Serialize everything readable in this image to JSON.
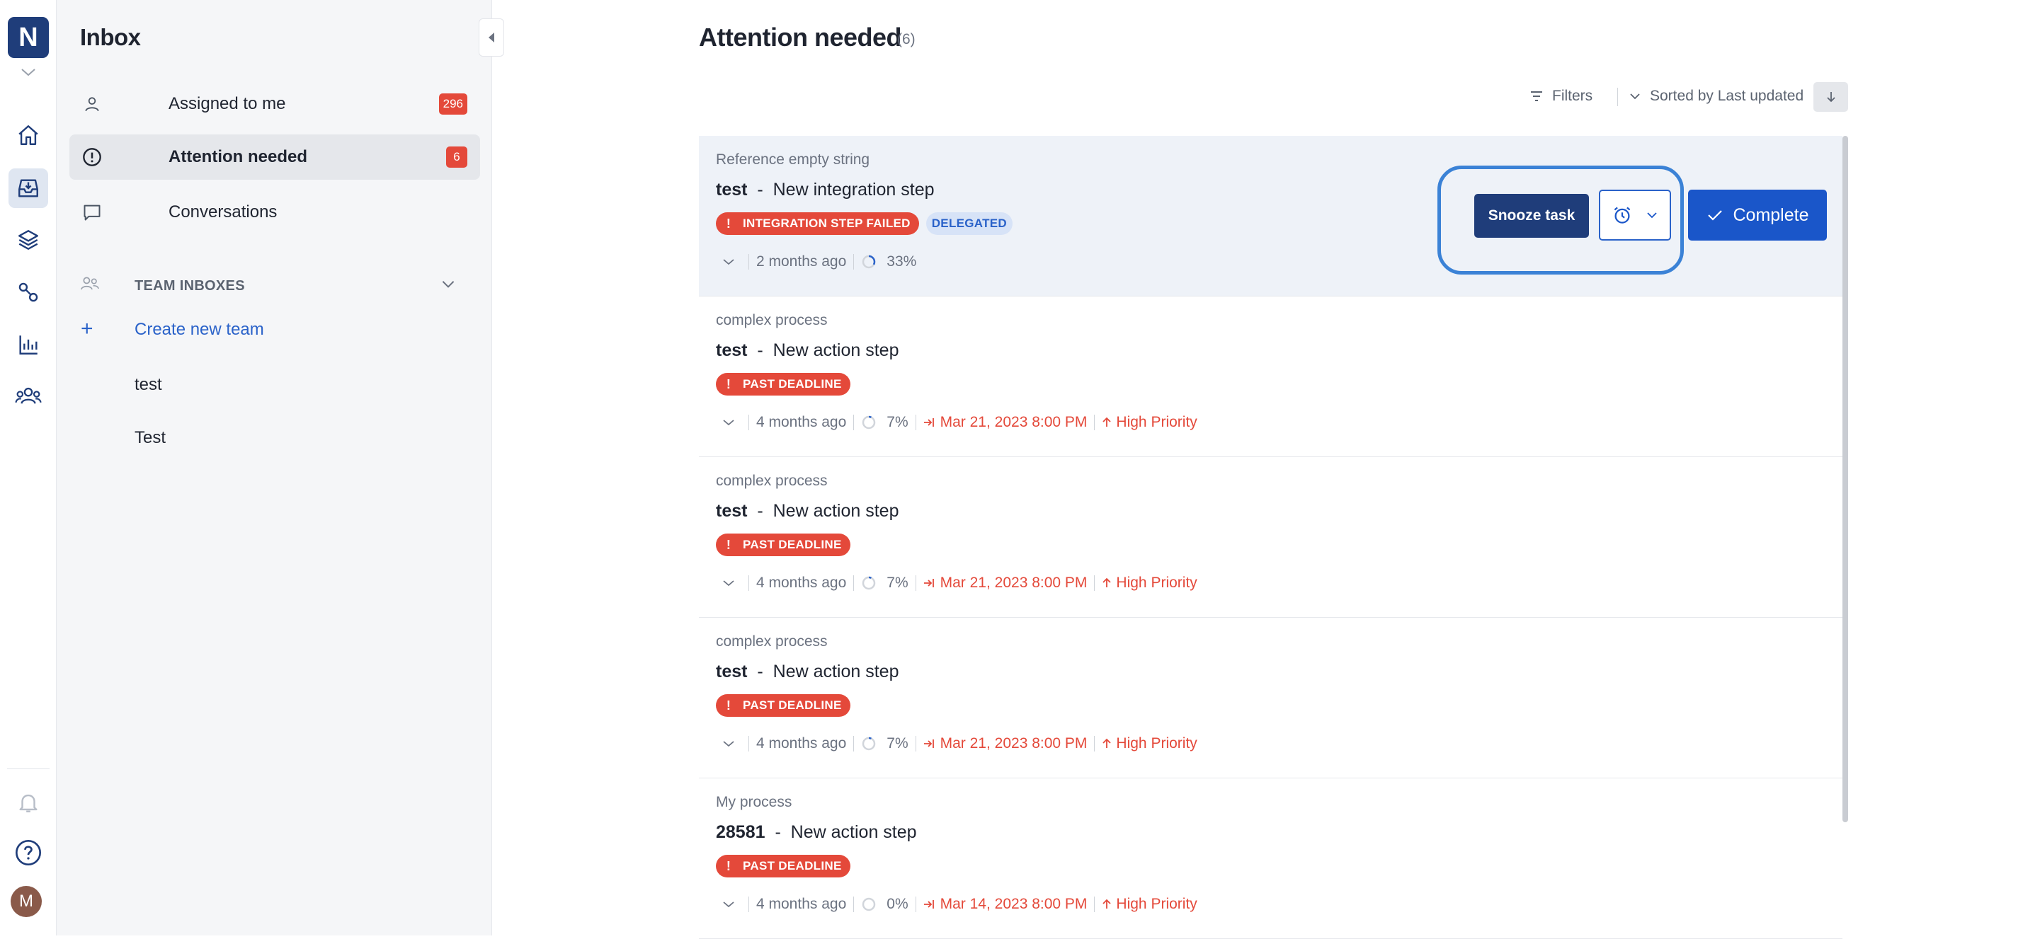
{
  "rail": {
    "logo_letter": "N",
    "avatar_initial": "M",
    "icons": [
      "home-icon",
      "inbox-icon",
      "layers-icon",
      "flow-icon",
      "chart-icon",
      "people-icon",
      "bell-icon",
      "help-icon"
    ]
  },
  "sidebar": {
    "title": "Inbox",
    "items": [
      {
        "label": "Assigned to me",
        "badge": "296"
      },
      {
        "label": "Attention needed",
        "badge": "6"
      },
      {
        "label": "Conversations",
        "badge": ""
      }
    ],
    "team_header": "TEAM INBOXES",
    "create_team": "Create new team",
    "teams": [
      "test",
      "Test"
    ]
  },
  "main": {
    "title": "Attention needed",
    "count": "(6)",
    "filters_label": "Filters",
    "sort_label": "Sorted by Last updated",
    "snooze_label": "Snooze task",
    "complete_label": "Complete",
    "tasks": [
      {
        "process": "Reference empty string",
        "id": "test",
        "dash": "-",
        "name": "New integration step",
        "tags": [
          "INTEGRATION STEP FAILED",
          "DELEGATED"
        ],
        "age": "2 months ago",
        "progress": "33%",
        "progress_value": 0.33,
        "due": "",
        "priority": ""
      },
      {
        "process": "complex process",
        "id": "test",
        "dash": "-",
        "name": "New action step",
        "tags": [
          "PAST DEADLINE"
        ],
        "age": "4 months ago",
        "progress": "7%",
        "progress_value": 0.07,
        "due": "Mar 21, 2023 8:00 PM",
        "priority": "High Priority"
      },
      {
        "process": "complex process",
        "id": "test",
        "dash": "-",
        "name": "New action step",
        "tags": [
          "PAST DEADLINE"
        ],
        "age": "4 months ago",
        "progress": "7%",
        "progress_value": 0.07,
        "due": "Mar 21, 2023 8:00 PM",
        "priority": "High Priority"
      },
      {
        "process": "complex process",
        "id": "test",
        "dash": "-",
        "name": "New action step",
        "tags": [
          "PAST DEADLINE"
        ],
        "age": "4 months ago",
        "progress": "7%",
        "progress_value": 0.07,
        "due": "Mar 21, 2023 8:00 PM",
        "priority": "High Priority"
      },
      {
        "process": "My process",
        "id": "28581",
        "dash": "-",
        "name": "New action step",
        "tags": [
          "PAST DEADLINE"
        ],
        "age": "4 months ago",
        "progress": "0%",
        "progress_value": 0.0,
        "due": "Mar 14, 2023 8:00 PM",
        "priority": "High Priority"
      }
    ]
  },
  "colors": {
    "brand": "#1f3d7a",
    "accent": "#1a56c9",
    "danger": "#e4493a",
    "focus": "#3b82d6"
  }
}
